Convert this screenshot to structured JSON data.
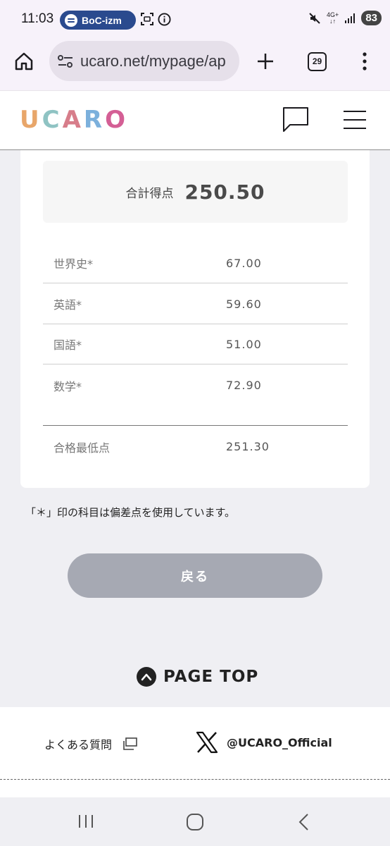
{
  "status_bar": {
    "time": "11:03",
    "media_pill": "BoC-izm",
    "network": "4G+",
    "battery": "83"
  },
  "browser": {
    "url": "ucaro.net/mypage/ap",
    "tab_count": "29"
  },
  "site": {
    "logo_letters": [
      "U",
      "C",
      "A",
      "R",
      "O"
    ],
    "logo_colors": [
      "#e8a66a",
      "#8fc3c3",
      "#d77d8a",
      "#7cb0dc",
      "#d45f95"
    ]
  },
  "results": {
    "total_label": "合計得点",
    "total_value": "250.50",
    "subjects": [
      {
        "name": "世界史*",
        "score": "67.00"
      },
      {
        "name": "英語*",
        "score": "59.60"
      },
      {
        "name": "国語*",
        "score": "51.00"
      },
      {
        "name": "数学*",
        "score": "72.90"
      }
    ],
    "min_pass_label": "合格最低点",
    "min_pass_value": "251.30"
  },
  "note": "「＊」印の科目は偏差点を使用しています。",
  "back_button": "戻る",
  "page_top": "PAGE TOP",
  "footer": {
    "faq": "よくある質問",
    "x_account": "@UCARO_Official"
  }
}
